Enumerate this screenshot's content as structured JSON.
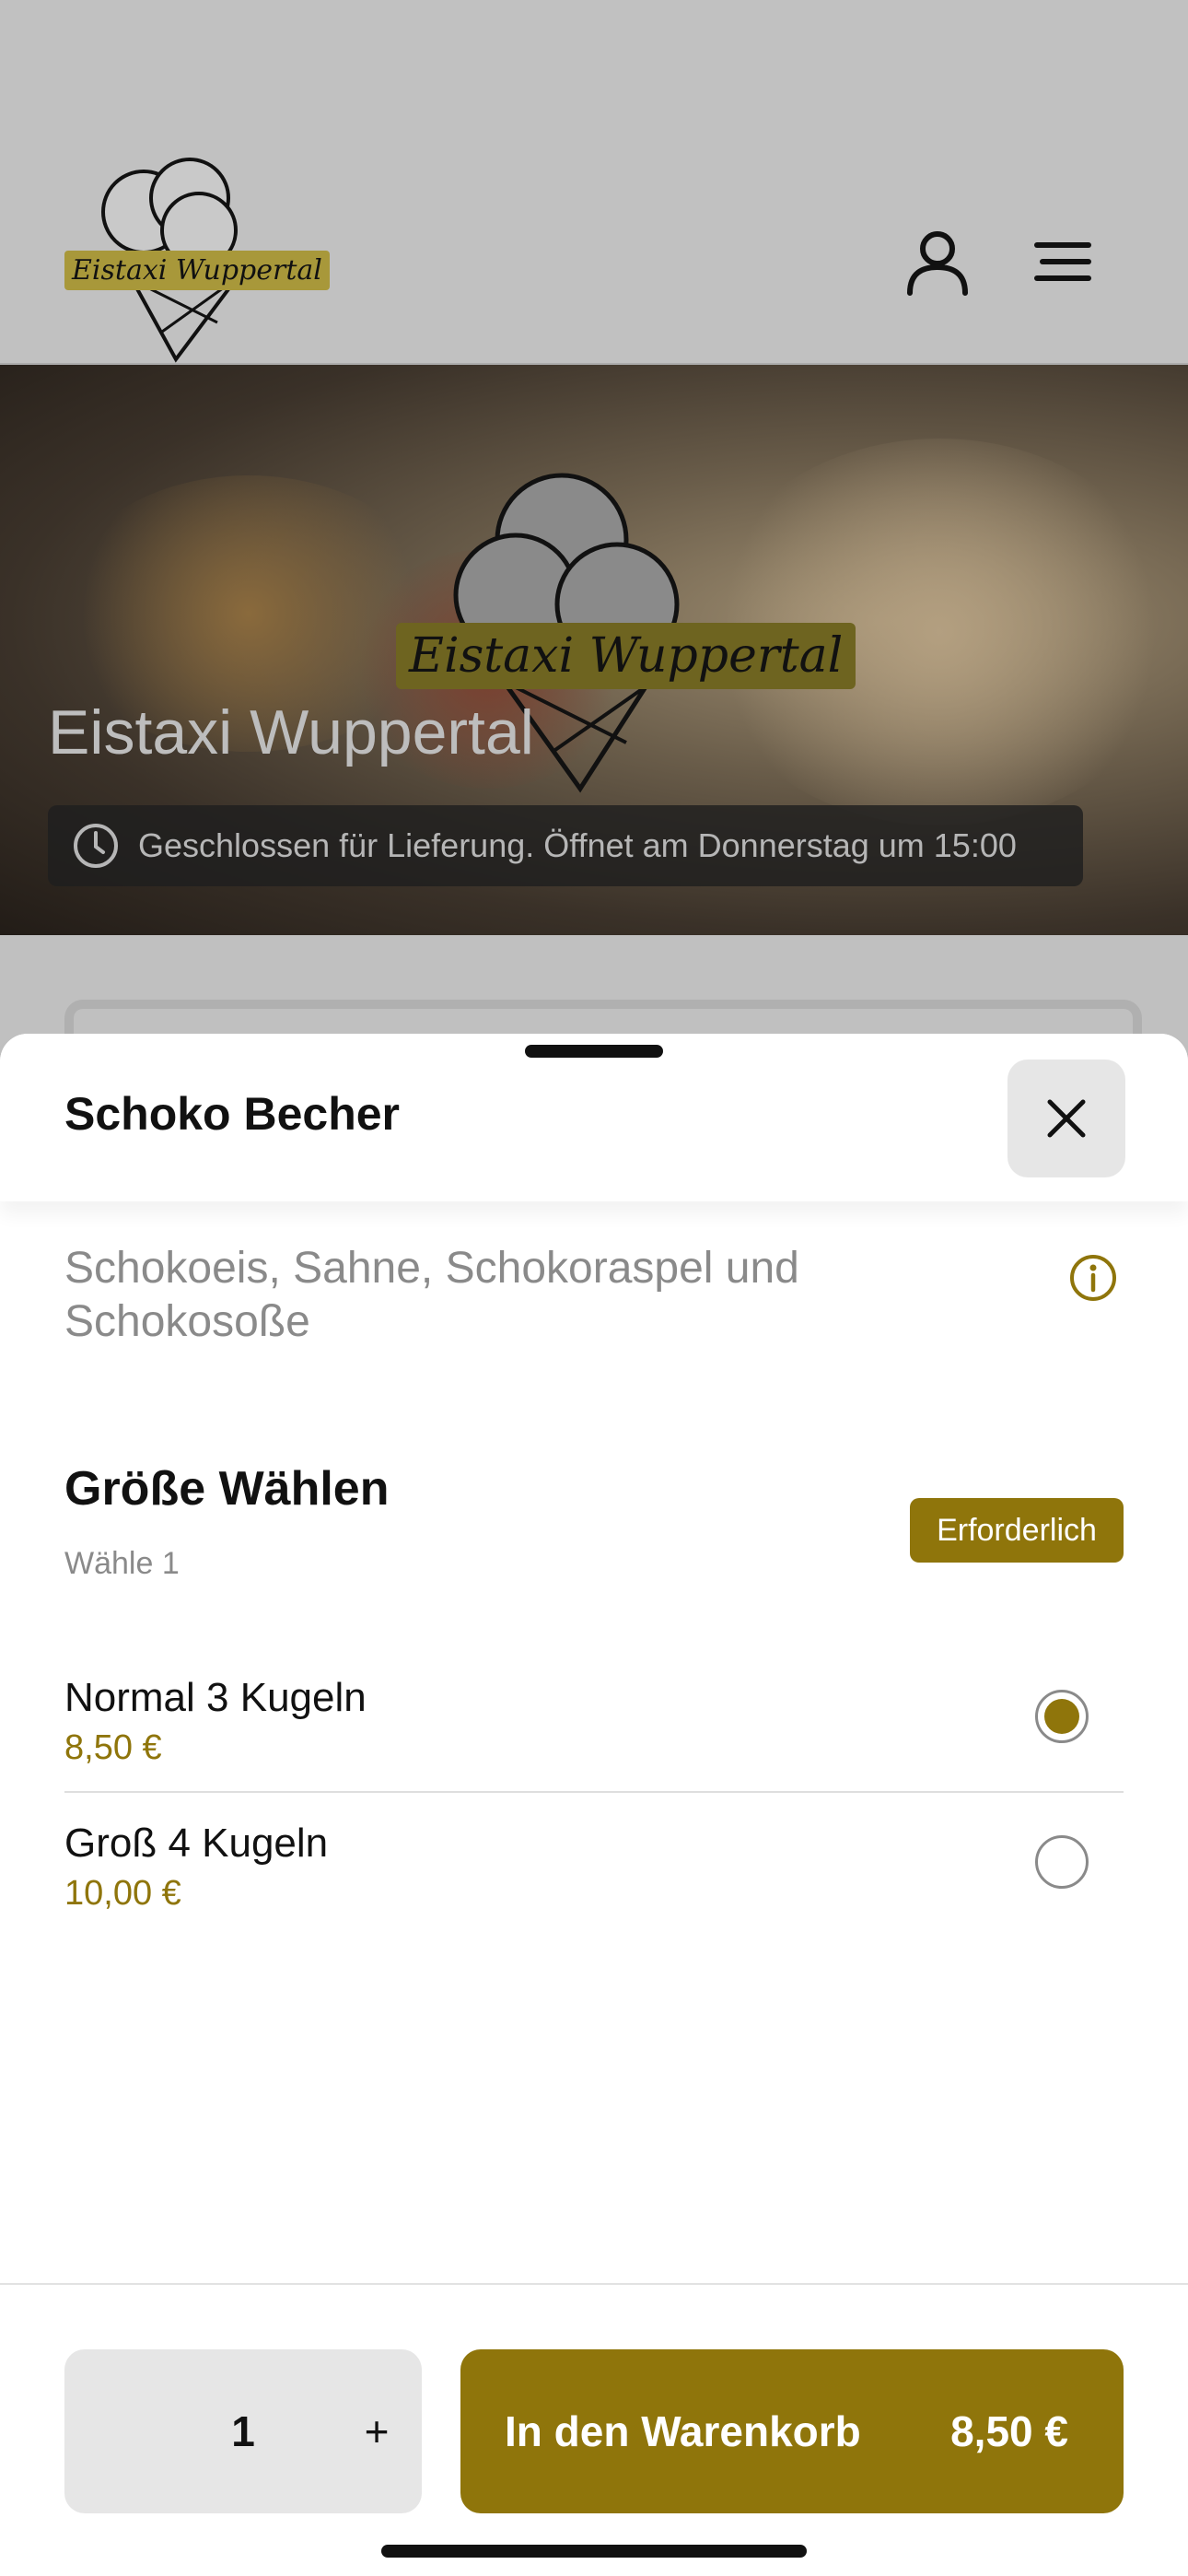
{
  "header": {
    "logo_text": "Eistaxi Wuppertal",
    "user_icon": "user-icon",
    "menu_icon": "hamburger-menu-icon"
  },
  "hero": {
    "logo_text": "Eistaxi Wuppertal",
    "title": "Eistaxi Wuppertal",
    "status": "Geschlossen für Lieferung. Öffnet am Donnerstag um 15:00",
    "status_icon": "clock-icon"
  },
  "sheet": {
    "title": "Schoko Becher",
    "close_icon": "close-icon",
    "description": "Schokoeis, Sahne, Schokoraspel und Schokosoße",
    "info_icon": "info-icon",
    "section": {
      "title": "Größe Wählen",
      "subtitle": "Wähle 1",
      "badge": "Erforderlich"
    },
    "options": [
      {
        "name": "Normal 3 Kugeln",
        "price": "8,50 €",
        "selected": true
      },
      {
        "name": "Groß 4 Kugeln",
        "price": "10,00 €",
        "selected": false
      }
    ]
  },
  "footer": {
    "quantity": "1",
    "plus": "+",
    "cart_label": "In den Warenkorb",
    "cart_price": "8,50 €"
  },
  "colors": {
    "accent": "#8f750b",
    "overlay": "#c0c0c0"
  }
}
